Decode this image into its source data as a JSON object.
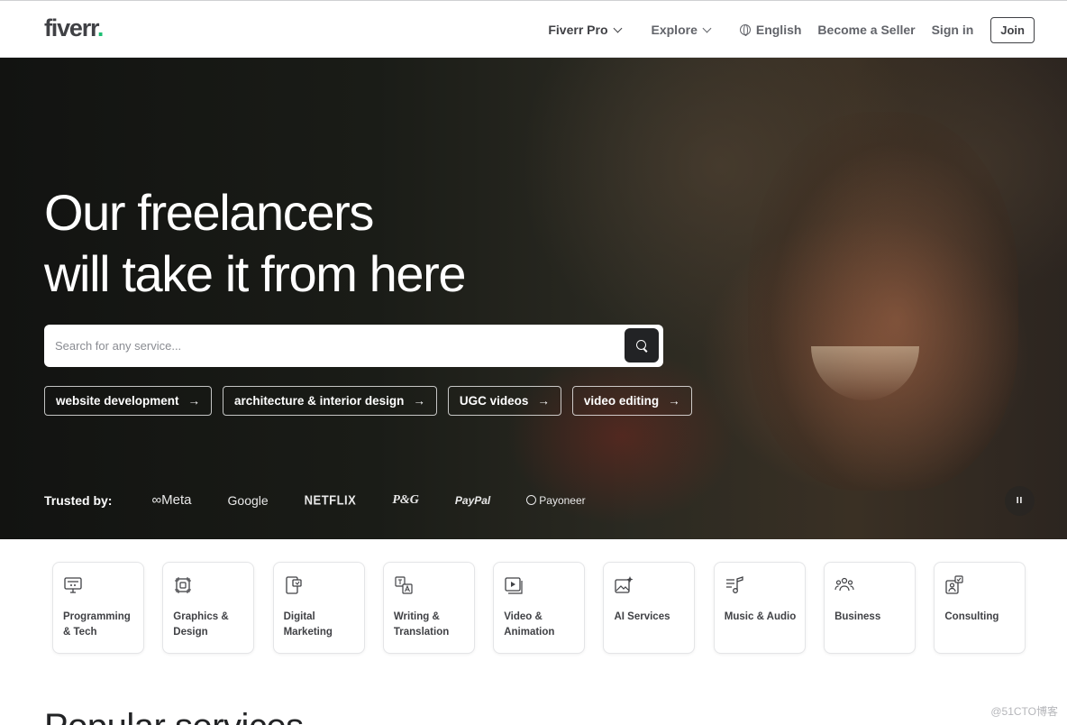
{
  "header": {
    "logo_text": "fiverr",
    "logo_dot": ".",
    "nav": {
      "fiverr_pro": "Fiverr Pro",
      "explore": "Explore",
      "language": "English",
      "become_seller": "Become a Seller",
      "sign_in": "Sign in",
      "join": "Join"
    }
  },
  "hero": {
    "title_line1": "Our freelancers",
    "title_line2": "will take it from here",
    "search": {
      "placeholder": "Search for any service..."
    },
    "chips": [
      {
        "label": "website development",
        "arrow": "→"
      },
      {
        "label": "architecture & interior design",
        "arrow": "→"
      },
      {
        "label": "UGC videos",
        "arrow": "→"
      },
      {
        "label": "video editing",
        "arrow": "→"
      }
    ],
    "trusted_label": "Trusted by:",
    "brands": [
      "∞Meta",
      "Google",
      "NETFLIX",
      "P&G",
      "PayPal",
      "Payoneer"
    ],
    "pause_glyph": "II"
  },
  "categories": [
    {
      "label": "Programming & Tech",
      "icon": "monitor-icon"
    },
    {
      "label": "Graphics & Design",
      "icon": "design-frame-icon"
    },
    {
      "label": "Digital Marketing",
      "icon": "marketing-phone-icon"
    },
    {
      "label": "Writing & Translation",
      "icon": "translation-icon"
    },
    {
      "label": "Video & Animation",
      "icon": "video-play-icon"
    },
    {
      "label": "AI Services",
      "icon": "ai-image-icon"
    },
    {
      "label": "Music & Audio",
      "icon": "music-note-icon"
    },
    {
      "label": "Business",
      "icon": "people-icon"
    },
    {
      "label": "Consulting",
      "icon": "consulting-icon"
    }
  ],
  "partial_section_title": "Popular services",
  "watermark": "@51CTO博客",
  "colors": {
    "brand_green": "#1dbf73",
    "text_dark": "#404145",
    "search_button": "#222325"
  }
}
